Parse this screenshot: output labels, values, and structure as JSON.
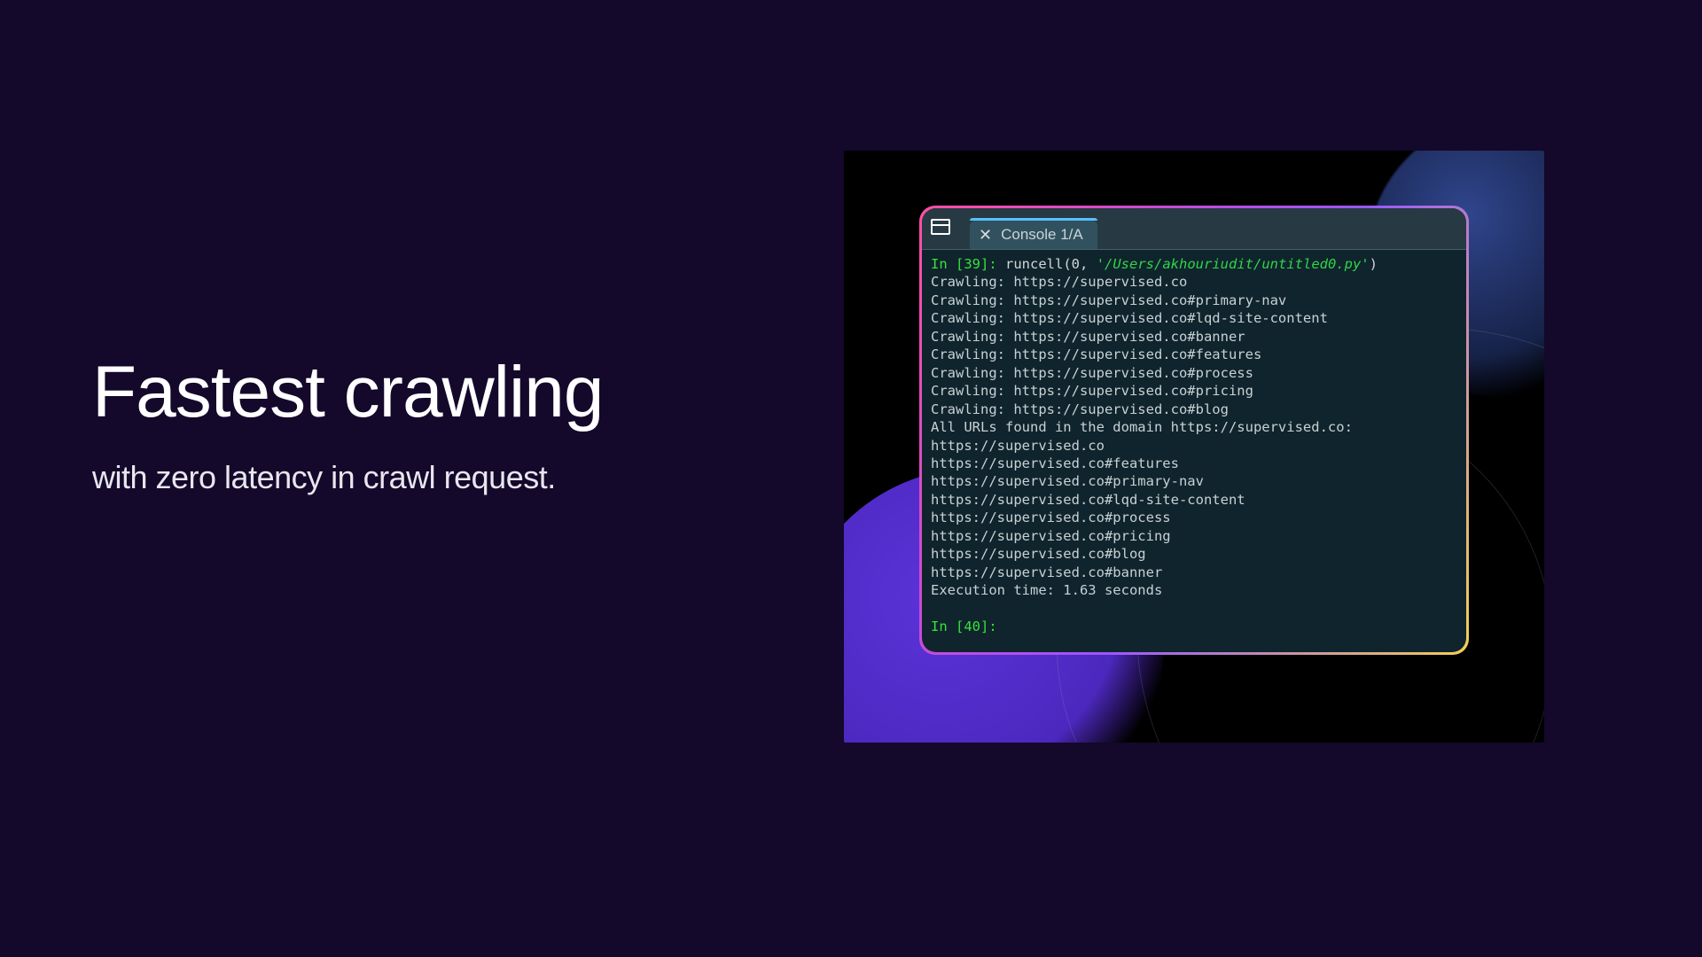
{
  "hero": {
    "headline": "Fastest crawling",
    "subline": "with zero latency in crawl request."
  },
  "console": {
    "tab_label": "Console 1/A",
    "prompt_in_1": "In [39]:",
    "runcell_fn": "runcell",
    "runcell_arg_num": "0",
    "runcell_arg_path": "'/Users/akhouriudit/untitled0.py'",
    "lines": [
      "Crawling: https://supervised.co",
      "Crawling: https://supervised.co#primary-nav",
      "Crawling: https://supervised.co#lqd-site-content",
      "Crawling: https://supervised.co#banner",
      "Crawling: https://supervised.co#features",
      "Crawling: https://supervised.co#process",
      "Crawling: https://supervised.co#pricing",
      "Crawling: https://supervised.co#blog",
      "All URLs found in the domain https://supervised.co:",
      "https://supervised.co",
      "https://supervised.co#features",
      "https://supervised.co#primary-nav",
      "https://supervised.co#lqd-site-content",
      "https://supervised.co#process",
      "https://supervised.co#pricing",
      "https://supervised.co#blog",
      "https://supervised.co#banner",
      "Execution time: 1.63 seconds"
    ],
    "prompt_in_2": "In [40]:"
  }
}
